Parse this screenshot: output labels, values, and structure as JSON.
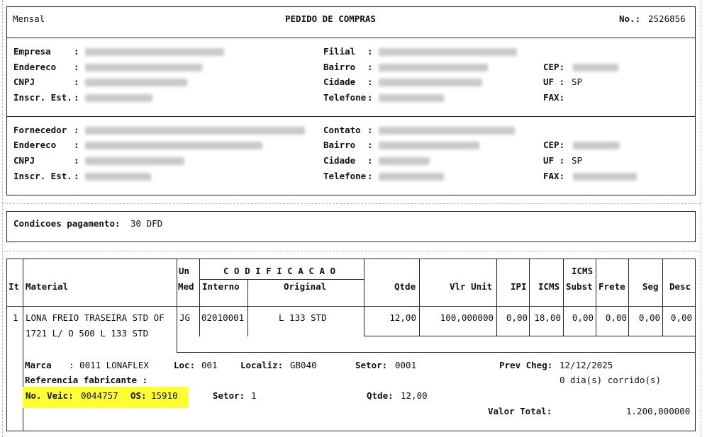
{
  "header": {
    "left": "Mensal",
    "title": "PEDIDO DE COMPRAS",
    "number_label": "No.:",
    "number": "2526856"
  },
  "company": {
    "empresa_label": "Empresa",
    "endereco_label": "Endereco",
    "cnpj_label": "CNPJ",
    "inscr_label": "Inscr. Est.",
    "filial_label": "Filial",
    "bairro_label": "Bairro",
    "cidade_label": "Cidade",
    "telefone_label": "Telefone",
    "cep_label": "CEP:",
    "uf_label": "UF :",
    "uf": "SP",
    "fax_label": "FAX:"
  },
  "supplier": {
    "fornecedor_label": "Fornecedor",
    "endereco_label": "Endereco",
    "cnpj_label": "CNPJ",
    "inscr_label": "Inscr. Est.",
    "contato_label": "Contato",
    "bairro_label": "Bairro",
    "cidade_label": "Cidade",
    "telefone_label": "Telefone",
    "cep_label": "CEP:",
    "uf_label": "UF :",
    "uf": "SP",
    "fax_label": "FAX:"
  },
  "payment": {
    "label": "Condicoes pagamento:",
    "value": "30 DFD"
  },
  "table": {
    "it": "It",
    "material": "Material",
    "un": "Un",
    "med": "Med",
    "codificacao": "C O D I F I C A C A O",
    "interno": "Interno",
    "original": "Original",
    "qtde": "Qtde",
    "vlr_unit": "Vlr Unit",
    "ipi": "IPI",
    "icms": "ICMS",
    "icms_subst_1": "ICMS",
    "icms_subst_2": "Subst",
    "frete": "Frete",
    "seg": "Seg",
    "desc": "Desc"
  },
  "item": {
    "it": "1",
    "material_line1": "LONA FREIO TRASEIRA  STD OF",
    "material_line2": "1721 L/ O 500 L 133 STD",
    "un": "JG",
    "interno": "02010001",
    "original": "L 133 STD",
    "qtde": "12,00",
    "vlr_unit": "100,000000",
    "ipi": "0,00",
    "icms": "18,00",
    "icms_subst": "0,00",
    "frete": "0,00",
    "seg": "0,00",
    "desc": "0,00"
  },
  "detail": {
    "marca_label": "Marca",
    "marca_value": ": 0011 LONAFLEX",
    "loc_label": "Loc:",
    "loc_value": "001",
    "localiz_label": "Localiz:",
    "localiz_value": "GB040",
    "setor_label": "Setor:",
    "setor_value": "0001",
    "prev_label": "Prev Cheg:",
    "prev_value": "12/12/2025",
    "ref_label": "Referencia fabricante :",
    "dias": "0 dia(s) corrido(s)",
    "veic_label": "No. Veic:",
    "veic_value": "0044757",
    "os_label": "OS:",
    "os_value": "15910",
    "setor2_label": "Setor:",
    "setor2_value": "1",
    "qtde_label": "Qtde:",
    "qtde_value": "12,00",
    "total_label": "Valor Total:",
    "total_value": "1.200,000000"
  },
  "colors": {
    "highlight": "#ffff33",
    "line": "#222222"
  }
}
